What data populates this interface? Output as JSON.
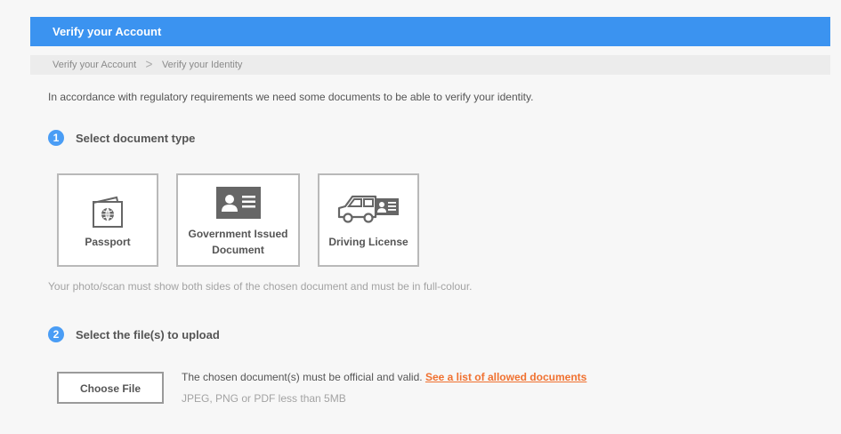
{
  "header": {
    "title": "Verify your Account",
    "color": "#3b93f0"
  },
  "breadcrumb": {
    "items": [
      "Verify your Account",
      "Verify your Identity"
    ],
    "separator": ">"
  },
  "intro": "In accordance with regulatory requirements we need some documents to be able to verify your identity.",
  "step1": {
    "number": "1",
    "label": "Select document type"
  },
  "documents": [
    {
      "label": "Passport",
      "icon": "passport-icon"
    },
    {
      "label": "Government Issued Document",
      "icon": "id-card-icon"
    },
    {
      "label": "Driving License",
      "icon": "car-license-icon"
    }
  ],
  "photo_note": "Your photo/scan must show both sides of the chosen document and must be in full-colour.",
  "step2": {
    "number": "2",
    "label": "Select the file(s) to upload"
  },
  "upload": {
    "button_label": "Choose File",
    "info_text": "The chosen document(s) must be official and valid.",
    "link_text": "See a list of allowed documents",
    "file_types": "JPEG, PNG or PDF less than 5MB"
  },
  "colors": {
    "accent": "#3b93f0",
    "step_badge": "#4a9df5",
    "link": "#f07130"
  }
}
